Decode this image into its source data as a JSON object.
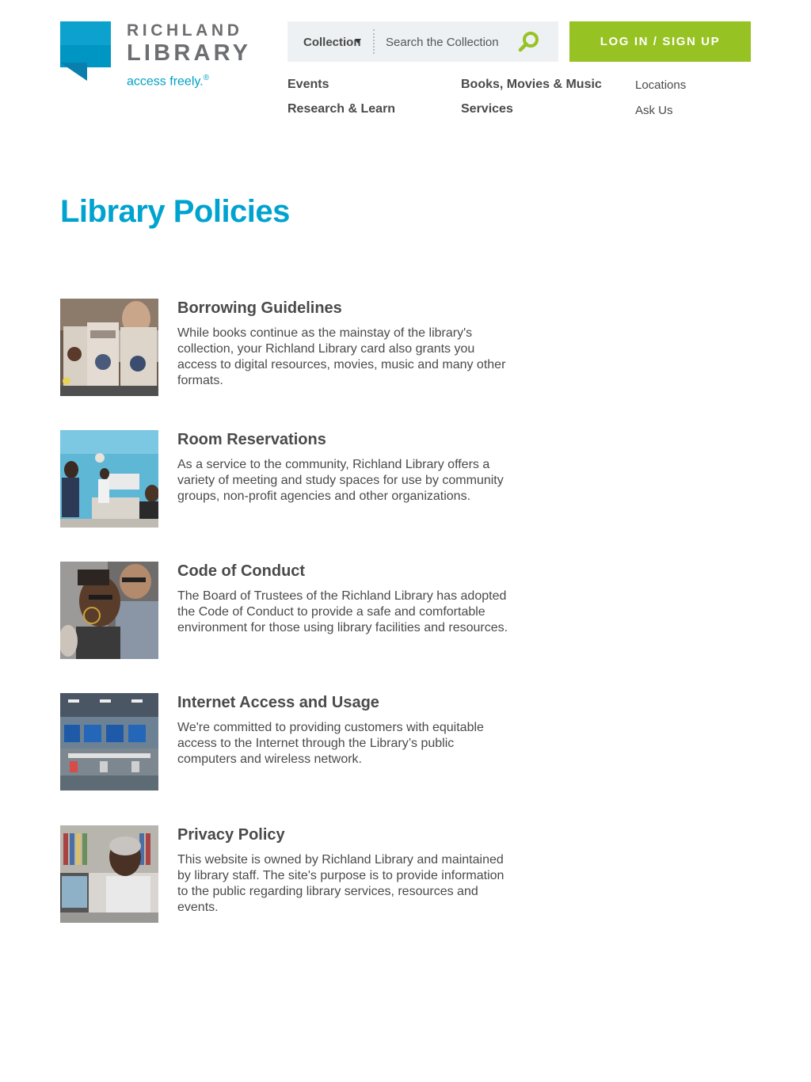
{
  "brand": {
    "name_line1": "RICHLAND",
    "name_line2": "LIBRARY",
    "tagline": "access freely.",
    "tagline_mark": "®",
    "colors": {
      "blue": "#00a3cf",
      "green": "#97c223",
      "gray": "#6d6e71"
    }
  },
  "search": {
    "scope_label": "Collection",
    "placeholder": "Search the Collection",
    "button_icon": "search-icon"
  },
  "login": {
    "label": "LOG IN / SIGN UP"
  },
  "nav": {
    "primary": [
      "Events",
      "Books, Movies & Music",
      "Research & Learn",
      "Services"
    ],
    "secondary": [
      "Locations",
      "Ask Us"
    ]
  },
  "page": {
    "title": "Library Policies"
  },
  "policies": [
    {
      "title": "Borrowing Guidelines",
      "description": "While books continue as the mainstay of the library's collection, your Richland Library card also grants you access to digital resources, movies, music and many other formats."
    },
    {
      "title": "Room Reservations",
      "description": "As a service to the community, Richland Library offers a variety of meeting and study spaces for use by community groups, non-profit agencies and other organizations."
    },
    {
      "title": "Code of Conduct",
      "description": "The Board of Trustees of the Richland Library has adopted the Code of Conduct to provide a safe and comfortable environment for those using library facilities and resources."
    },
    {
      "title": "Internet Access and Usage",
      "description": "We're committed to providing customers with equitable access to the Internet through the Library’s public computers and wireless network."
    },
    {
      "title": "Privacy Policy",
      "description": "This website is owned by Richland Library and maintained by library staff. The site's purpose is to provide information to the public regarding library services, resources and events."
    }
  ]
}
